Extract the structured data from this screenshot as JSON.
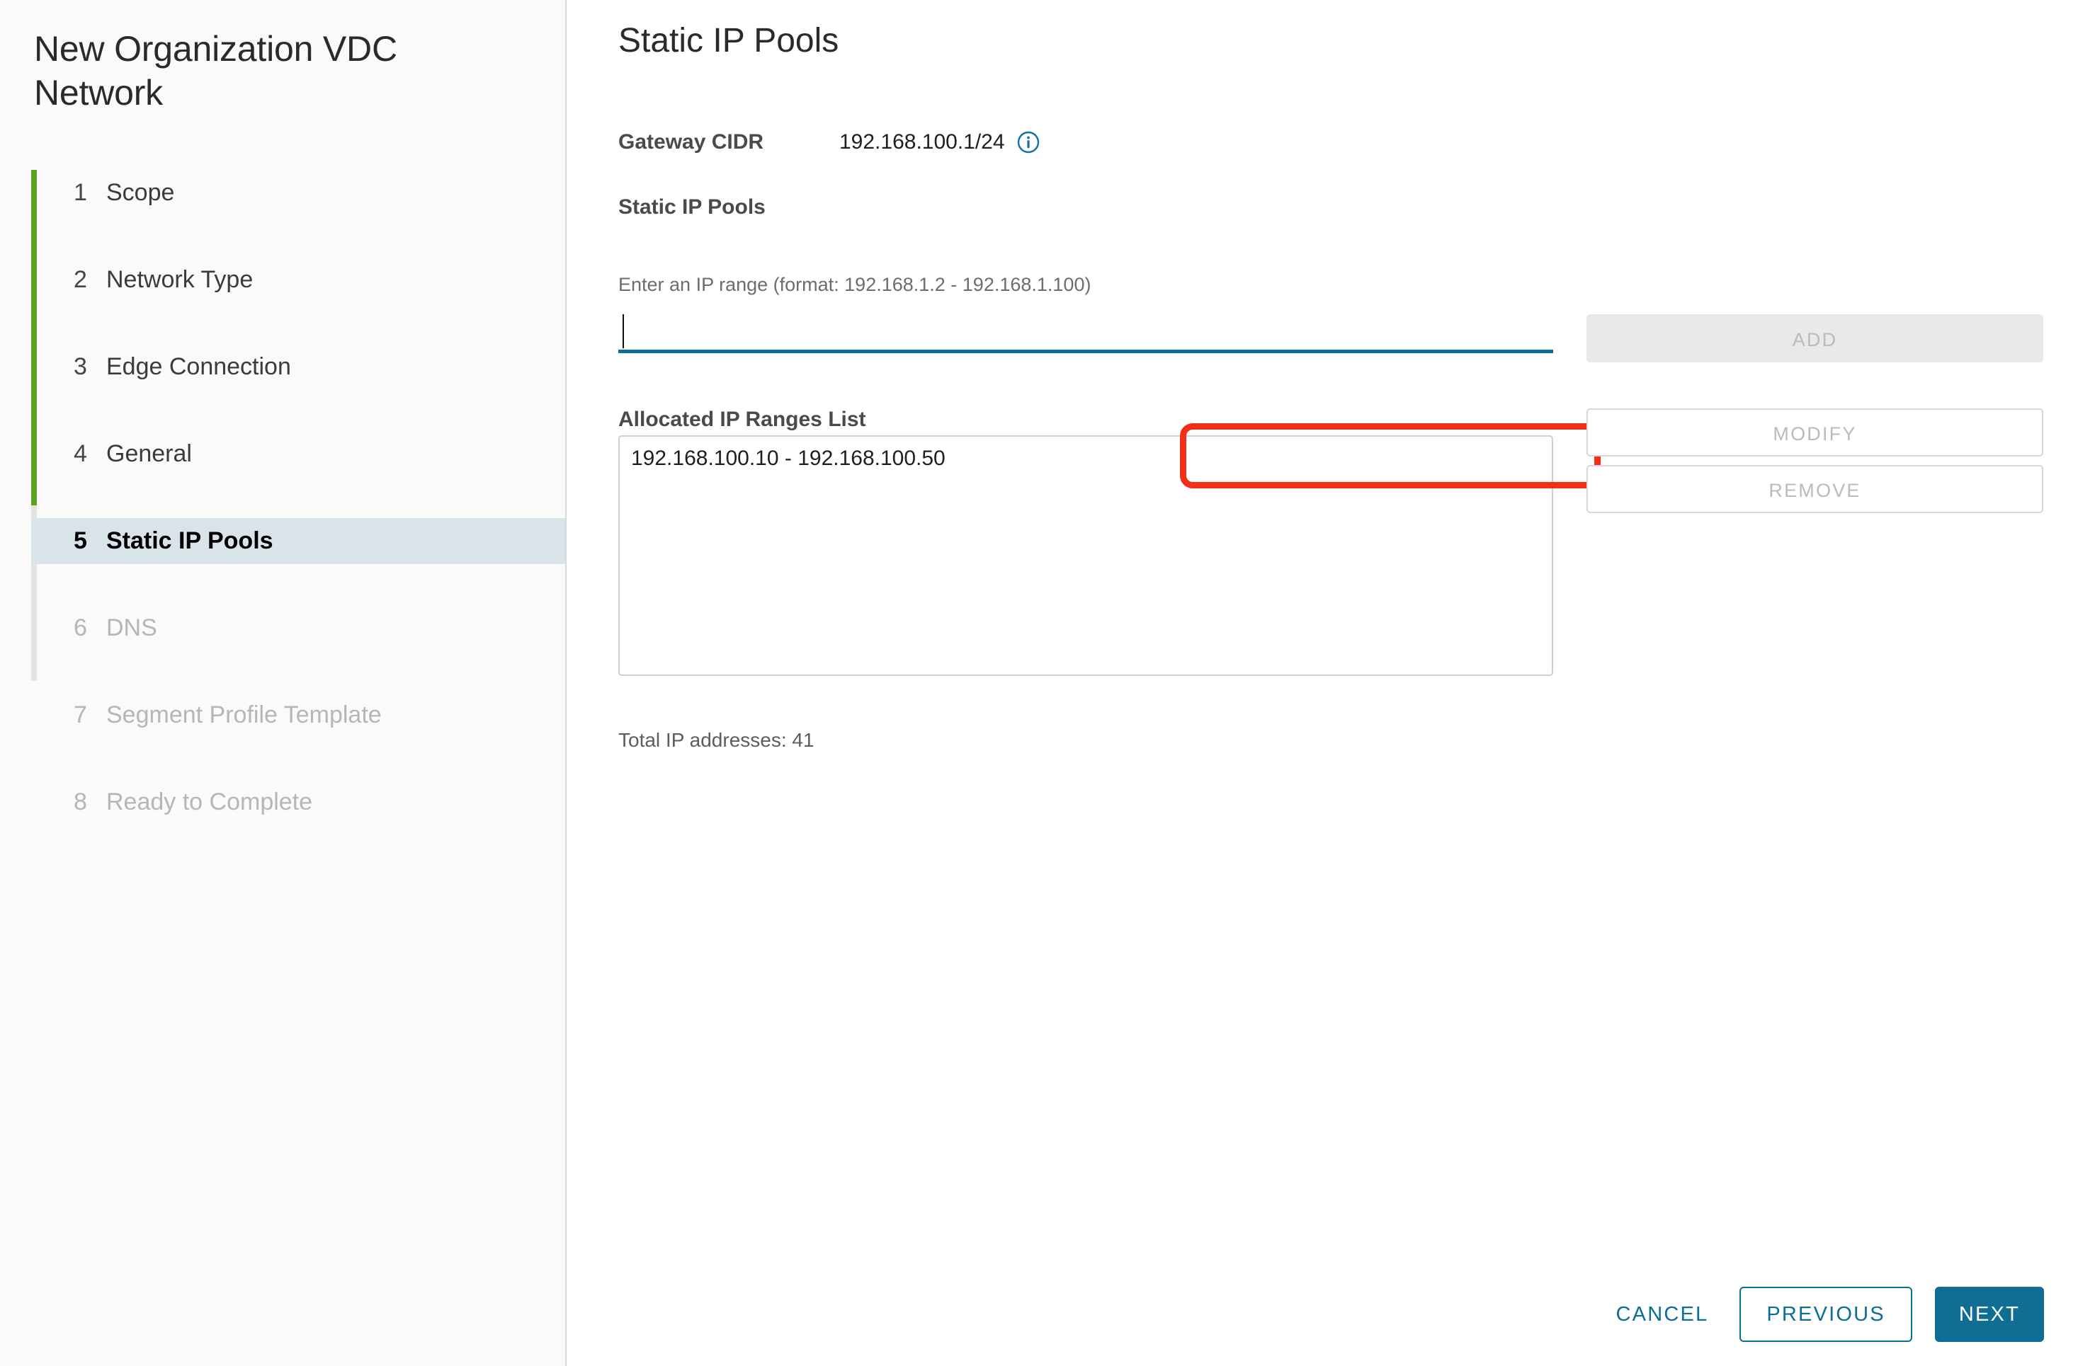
{
  "wizard": {
    "title": "New Organization VDC Network",
    "accent_green": "#5aa220",
    "accent_blue": "#0f6e94",
    "annotation_color": "#f42f17",
    "steps": [
      {
        "number": "1",
        "label": "Scope",
        "state": "complete"
      },
      {
        "number": "2",
        "label": "Network Type",
        "state": "complete"
      },
      {
        "number": "3",
        "label": "Edge Connection",
        "state": "complete"
      },
      {
        "number": "4",
        "label": "General",
        "state": "complete"
      },
      {
        "number": "5",
        "label": "Static IP Pools",
        "state": "active"
      },
      {
        "number": "6",
        "label": "DNS",
        "state": "disabled"
      },
      {
        "number": "7",
        "label": "Segment Profile Template",
        "state": "disabled"
      },
      {
        "number": "8",
        "label": "Ready to Complete",
        "state": "disabled"
      }
    ]
  },
  "page": {
    "title": "Static IP Pools",
    "gateway": {
      "label": "Gateway CIDR",
      "value": "192.168.100.1/24",
      "info_icon": "info-circle-icon"
    },
    "section_label": "Static IP Pools",
    "ip_range_field": {
      "help": "Enter an IP range (format: 192.168.1.2 - 192.168.1.100)",
      "value": "",
      "placeholder": ""
    },
    "allocated": {
      "label": "Allocated IP Ranges List",
      "items": [
        "192.168.100.10 - 192.168.100.50"
      ]
    },
    "total_ip": "Total IP addresses: 41"
  },
  "actions": {
    "add": "ADD",
    "modify": "MODIFY",
    "remove": "REMOVE"
  },
  "footer": {
    "cancel": "CANCEL",
    "previous": "PREVIOUS",
    "next": "NEXT"
  }
}
